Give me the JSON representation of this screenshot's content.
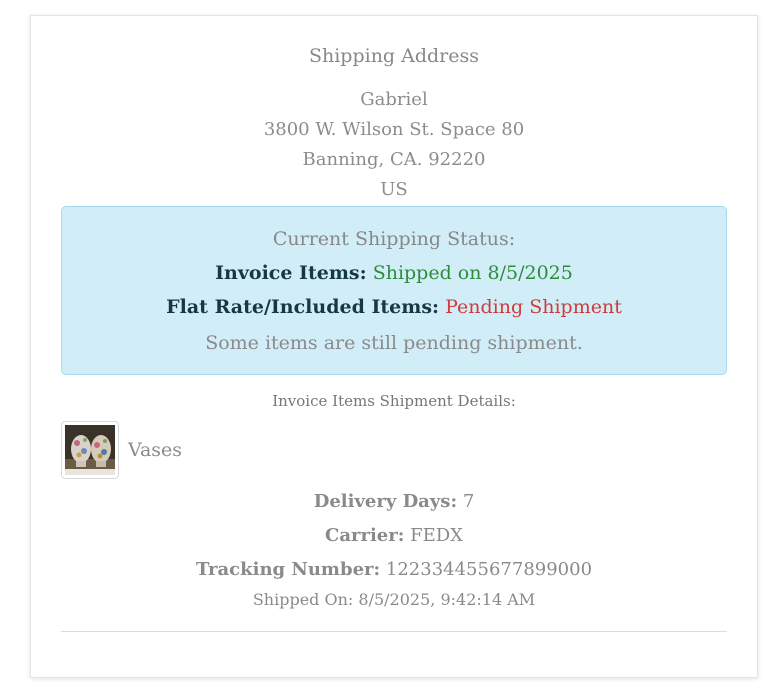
{
  "shipping_address": {
    "title": "Shipping Address",
    "name": "Gabriel",
    "street": "3800 W. Wilson St. Space 80",
    "city_line": "Banning, CA. 92220",
    "country": "US"
  },
  "status": {
    "title": "Current Shipping Status:",
    "invoice_label": "Invoice Items:",
    "invoice_value": "Shipped on 8/5/2025",
    "flat_label": "Flat Rate/Included Items:",
    "flat_value": "Pending Shipment",
    "note": "Some items are still pending shipment.",
    "colors": {
      "box_bg": "#d1eef8",
      "shipped": "#2f8b3c",
      "pending": "#cf3b3b"
    }
  },
  "shipment_details": {
    "title": "Invoice Items Shipment Details:",
    "item": {
      "name": "Vases",
      "thumbnail": "vases-thumbnail"
    },
    "delivery_days_label": "Delivery Days:",
    "delivery_days_value": "7",
    "carrier_label": "Carrier:",
    "carrier_value": "FEDX",
    "tracking_label": "Tracking Number:",
    "tracking_value": "122334455677899000",
    "shipped_on": "Shipped On: 8/5/2025, 9:42:14 AM"
  }
}
